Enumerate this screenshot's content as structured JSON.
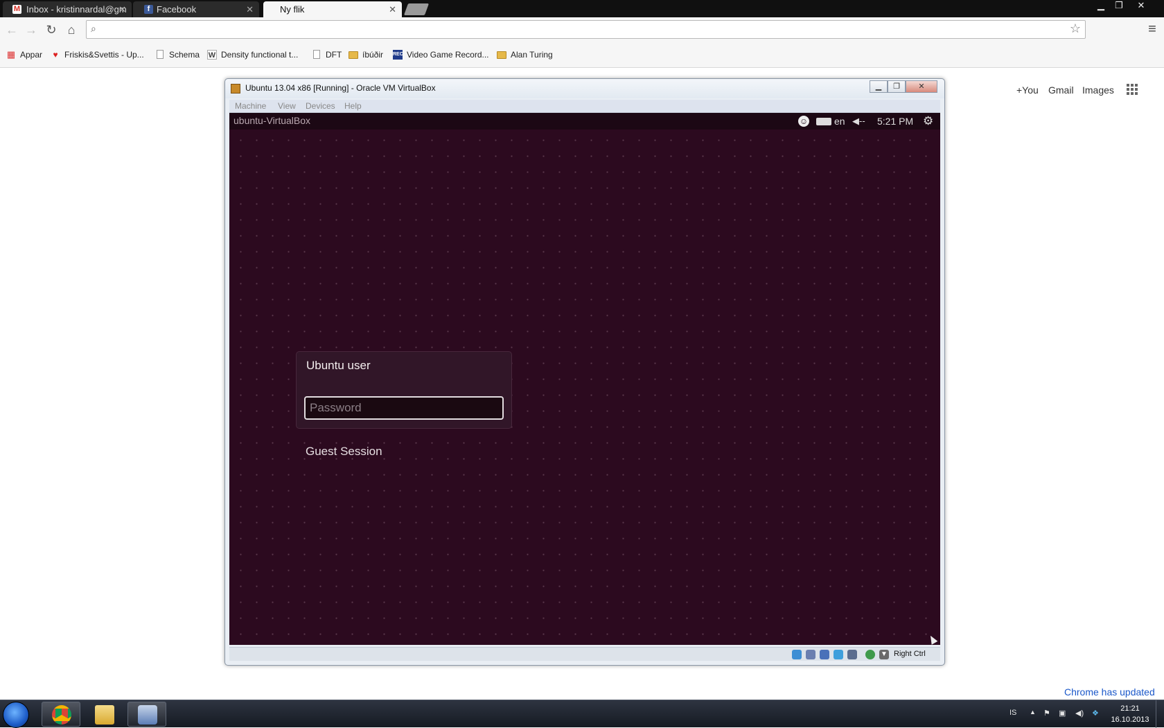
{
  "browser": {
    "tabs": [
      {
        "title": "Inbox - kristinnardal@gm",
        "icon": "gmail-icon"
      },
      {
        "title": "Facebook",
        "icon": "facebook-icon"
      },
      {
        "title": "Ny flik",
        "icon": "none"
      }
    ],
    "omnibox_value": "",
    "bookmarks": [
      {
        "label": "Appar",
        "icon": "apps-grid-icon"
      },
      {
        "label": "Friskis&Svettis - Up...",
        "icon": "friskis-icon"
      },
      {
        "label": "Schema",
        "icon": "page-icon"
      },
      {
        "label": "Density functional t...",
        "icon": "wiki-icon"
      },
      {
        "label": "DFT",
        "icon": "page-icon"
      },
      {
        "label": "íbúðir",
        "icon": "folder-icon"
      },
      {
        "label": "Video Game Record...",
        "icon": "rec-icon"
      },
      {
        "label": "Alan Turing",
        "icon": "folder-icon"
      }
    ],
    "google_links": {
      "plus": "+You",
      "gmail": "Gmail",
      "images": "Images"
    },
    "update_notice": "Chrome has updated"
  },
  "vbox": {
    "title": "Ubuntu 13.04 x86 [Running] - Oracle VM VirtualBox",
    "menu": [
      "Machine",
      "View",
      "Devices",
      "Help"
    ],
    "status_hostkey": "Right Ctrl",
    "guest": {
      "hostname": "ubuntu-VirtualBox",
      "keyboard_layout": "en",
      "time": "5:21 PM",
      "user_name": "Ubuntu user",
      "password_placeholder": "Password",
      "guest_session": "Guest Session"
    }
  },
  "taskbar": {
    "language": "IS",
    "time": "21:21",
    "date": "16.10.2013",
    "apps": [
      "chrome-icon",
      "explorer-icon",
      "virtualbox-icon"
    ]
  },
  "colors": {
    "ubuntu_bg": "#2c0a1f",
    "ubuntu_panel": "#1c0814",
    "link_blue": "#1a57c9"
  }
}
